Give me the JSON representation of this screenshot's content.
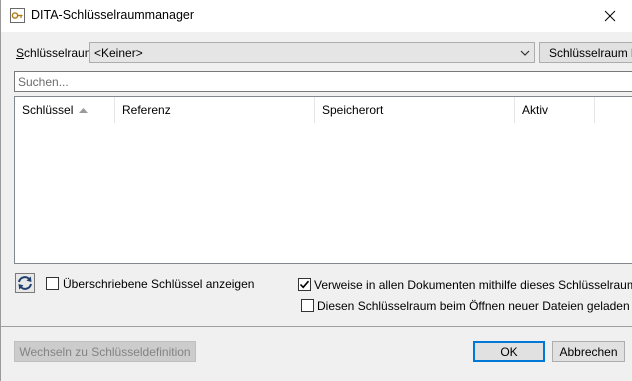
{
  "window": {
    "title": "DITA-Schlüsselraummanager"
  },
  "keyspace": {
    "label": "Schlüsselraum:",
    "selected": "<Keiner>",
    "load_button": "Schlüsselraum laden"
  },
  "search": {
    "placeholder": "Suchen..."
  },
  "table": {
    "columns": [
      "Schlüssel",
      "Referenz",
      "Speicherort",
      "Aktiv"
    ],
    "rows": []
  },
  "options": {
    "show_overwritten": {
      "label": "Überschriebene Schlüssel anzeigen",
      "checked": false
    },
    "resolve_in_all_docs": {
      "label": "Verweise in allen Dokumenten mithilfe dieses Schlüsselraums aktualisieren",
      "checked": true
    },
    "keep_loaded": {
      "label": "Diesen Schlüsselraum beim Öffnen neuer Dateien geladen lassen",
      "checked": false
    }
  },
  "footer": {
    "switch_button": "Wechseln zu Schlüsseldefinition",
    "ok_button": "OK",
    "cancel_button": "Abbrechen"
  },
  "icons": {
    "app": "key-icon",
    "close": "close-icon",
    "combo_arrow": "chevron-down-icon",
    "sort": "sort-ascending-icon",
    "refresh": "refresh-icon",
    "check": "checkmark-icon"
  }
}
